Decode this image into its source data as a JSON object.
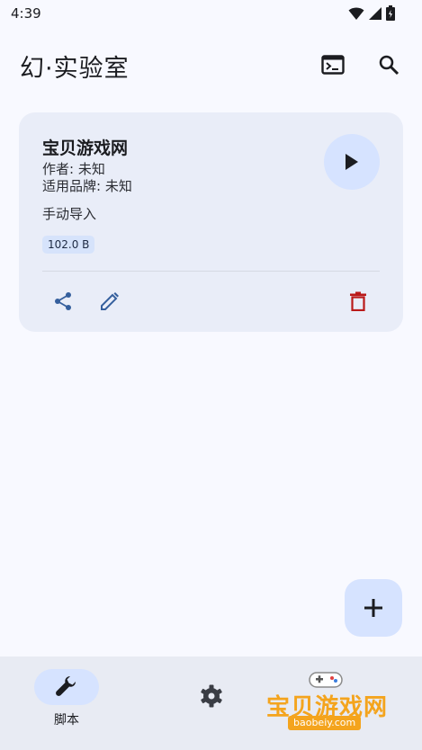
{
  "status_bar": {
    "time": "4:39"
  },
  "app_bar": {
    "title": "幻·实验室"
  },
  "script_card": {
    "title": "宝贝游戏网",
    "author": "作者: 未知",
    "brand": "适用品牌: 未知",
    "source": "手动导入",
    "size": "102.0 B"
  },
  "bottom_nav": {
    "items": [
      {
        "label": "脚本",
        "icon": "wrench-icon",
        "active": true
      },
      {
        "label": "",
        "icon": "gear-icon",
        "active": false
      }
    ]
  },
  "watermark": {
    "text": "宝贝游戏网",
    "url": "baobeiy.com"
  },
  "colors": {
    "accent_container": "#d6e3ff",
    "card_bg": "#e9edf8",
    "delete": "#ba1a1a",
    "primary": "#355f9d"
  }
}
